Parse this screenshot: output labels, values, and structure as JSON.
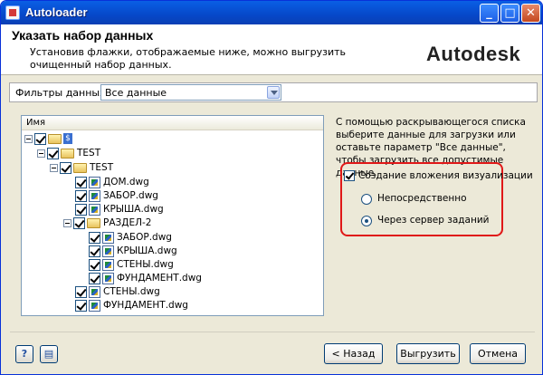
{
  "window": {
    "title": "Autoloader"
  },
  "title_buttons": {
    "minimize": "_",
    "maximize": "□",
    "close": "✕"
  },
  "header": {
    "title": "Указать набор данных",
    "description": "Установив флажки, отображаемые ниже, можно выгрузить очищенный набор данных.",
    "logo": "Autodesk"
  },
  "filter": {
    "label": "Фильтры данных:",
    "value": "Все данные"
  },
  "tree": {
    "column_header": "Имя",
    "root_badge": "$",
    "items": [
      {
        "label": "TEST"
      },
      {
        "label": "TEST"
      },
      {
        "label": "ДОМ.dwg"
      },
      {
        "label": "ЗАБОР.dwg"
      },
      {
        "label": "КРЫША.dwg"
      },
      {
        "label": "РАЗДЕЛ-2"
      },
      {
        "label": "ЗАБОР.dwg"
      },
      {
        "label": "КРЫША.dwg"
      },
      {
        "label": "СТЕНЫ.dwg"
      },
      {
        "label": "ФУНДАМЕНТ.dwg"
      },
      {
        "label": "СТЕНЫ.dwg"
      },
      {
        "label": "ФУНДАМЕНТ.dwg"
      }
    ]
  },
  "info": {
    "text": "С помощью раскрывающегося списка выберите данные для загрузки или оставьте параметр \"Все данные\", чтобы загрузить все допустимые данные."
  },
  "visualization": {
    "checkbox_label": "Создание вложения визуализации",
    "checked": true,
    "options": [
      {
        "label": "Непосредственно",
        "selected": false
      },
      {
        "label": "Через сервер заданий",
        "selected": true
      }
    ]
  },
  "footer": {
    "help_icon": "?",
    "clipboard_icon": "▤",
    "back_label": "< Назад",
    "upload_label": "Выгрузить",
    "cancel_label": "Отмена"
  },
  "colors": {
    "titlebar": "#0648c9",
    "highlight": "#e01818"
  }
}
